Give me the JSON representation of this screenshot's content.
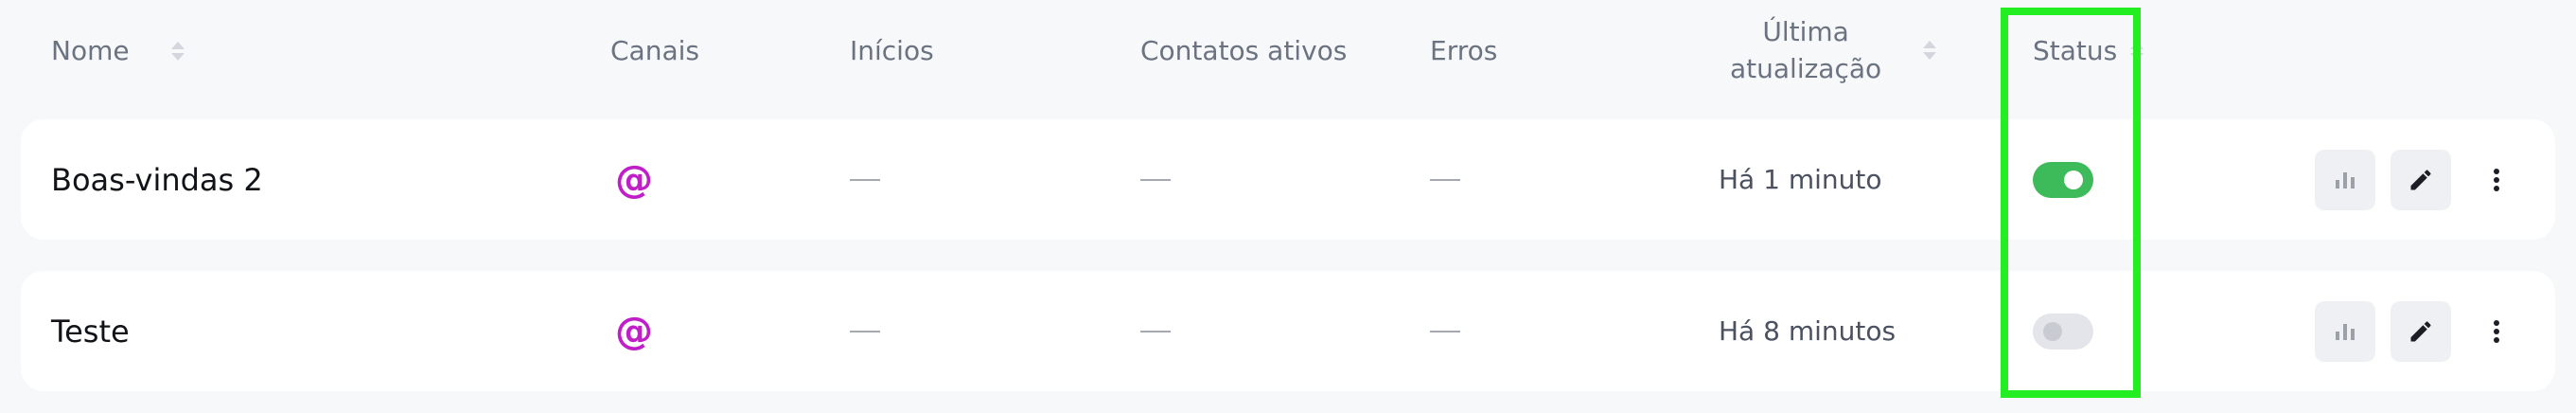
{
  "columns": {
    "name": "Nome",
    "channels": "Canais",
    "starts": "Inícios",
    "active_contacts": "Contatos ativos",
    "errors": "Erros",
    "last_update_line1": "Última",
    "last_update_line2": "atualização",
    "status": "Status"
  },
  "rows": [
    {
      "name": "Boas-vindas 2",
      "channel_symbol": "@",
      "channel_icon": "email-at-icon",
      "last_update": "Há 1 minuto",
      "status_on": true
    },
    {
      "name": "Teste",
      "channel_symbol": "@",
      "channel_icon": "email-at-icon",
      "last_update": "Há 8 minutos",
      "status_on": false
    }
  ],
  "colors": {
    "channel_accent": "#c01fc8",
    "toggle_on": "#3dbb5b",
    "toggle_off": "#e3e5ea",
    "highlight": "#22ee22"
  },
  "icons": {
    "analytics": "bar-chart-icon",
    "edit": "pencil-icon",
    "more": "vertical-dots-icon"
  }
}
